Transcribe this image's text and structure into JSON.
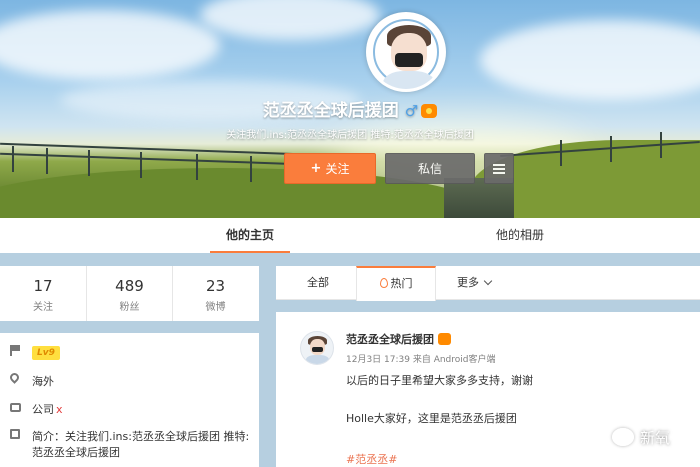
{
  "profile": {
    "name": "范丞丞全球后援团",
    "gender_symbol": "♂",
    "intro": "关注我们.ins:范丞丞全球后援团 推特:范丞丞全球后援团",
    "follow_plus": "+",
    "follow_label": "关注",
    "message_label": "私信"
  },
  "main_tabs": [
    {
      "label": "他的主页",
      "active": true
    },
    {
      "label": "他的相册",
      "active": false
    }
  ],
  "stats": [
    {
      "value": "17",
      "label": "关注"
    },
    {
      "value": "489",
      "label": "粉丝"
    },
    {
      "value": "23",
      "label": "微博"
    }
  ],
  "info": {
    "level": "Lv9",
    "location": "海外",
    "company": "公司",
    "company_mark": "x",
    "bio": "简介：关注我们.ins:范丞丞全球后援团 推特:范丞丞全球后援团"
  },
  "feed_tabs": {
    "all": "全部",
    "hot": "热门",
    "more": "更多"
  },
  "post": {
    "author": "范丞丞全球后援团",
    "meta": "12月3日 17:39 来自 Android客户端",
    "line1": "以后的日子里希望大家多多支持，谢谢",
    "line2": "Holle大家好，这里是范丞丞后援团",
    "tag": "#范丞丞#"
  },
  "watermark": {
    "text": "新氧"
  },
  "colors": {
    "accent": "#fa7d3c",
    "page_bg": "#b6cfe0",
    "tag": "#eb7350",
    "level_badge": "#ffdf3f"
  },
  "icons": {
    "level": "flag-icon",
    "location": "location-pin-icon",
    "company": "briefcase-icon",
    "bio": "edit-icon"
  }
}
